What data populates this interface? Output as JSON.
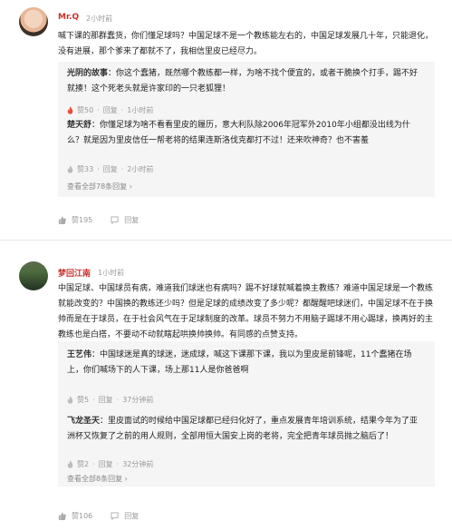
{
  "comments": [
    {
      "user": "Mr.Q",
      "time": "2小时前",
      "text": "喊下课的那群蠢货，你们懂足球吗？中国足球不是一个教练能左右的，中国足球发展几十年，只能退化，没有进展，那个爹来了都就不了，我相信里皮已经尽力。",
      "replies": [
        {
          "name": "光阴的故事",
          "text": "你这个蠢猪，既然哪个教练都一样，为啥不找个便宜的，或者干脆换个打手，踢不好就揍！这个死老头就是许家印的一只老狐狸！",
          "likes": "赞50",
          "reply": "回复",
          "time": "1小时前"
        },
        {
          "name": "楚天舒",
          "text": "你懂足球为啥不看看里皮的履历，意大利队除2006年冠军外2010年小组都没出线为什么？就是因为里皮信任一帮老将的结果连斯洛伐克都打不过！还来吹神奇？也不害羞",
          "likes": "赞33",
          "reply": "回复",
          "time": "2小时前"
        }
      ],
      "see_all": "查看全部78条回复 ›",
      "likes": "赞195",
      "reply": "回复"
    },
    {
      "user": "梦回江南",
      "time": "1小时前",
      "text": "中国足球、中国球员有病，难道我们球迷也有病吗？踢不好球就喊着换主教练？难道中国足球是一个教练就能改变的？中国换的教练还少吗？但是足球的成绩改变了多少呢？都醒醒吧球迷们，中国足球不在于换帅而是在于球员，在于社会风气在于足球制度的改革。球员不努力不用脑子踢球不用心踢球，换再好的主教练也是白搭，不要动不动就瞎起哄换帅换帅。有同感的点赞支持。",
      "replies": [
        {
          "name": "王艺伟",
          "text": "中国球迷是真的球迷，迷成球，喊这下课那下课，我以为里皮是前锋呢，11个蠢猪在场上，你们喊场下的人下课，场上那11人是你爸爸啊",
          "likes": "赞5",
          "reply": "回复",
          "time": "37分钟前"
        },
        {
          "name": "飞龙圣天",
          "text": "里皮面试的时候给中国足球都已经归化好了，重点发展青年培训系统，结果今年为了亚洲杯又恢复了之前的用人规则，全部用恒大国安上岗的老将，完全把青年球员抛之脑后了！",
          "likes": "赞2",
          "reply": "回复",
          "time": "32分钟前"
        }
      ],
      "see_all": "查看全部8条回复 ›",
      "likes": "赞106",
      "reply": "回复"
    }
  ]
}
